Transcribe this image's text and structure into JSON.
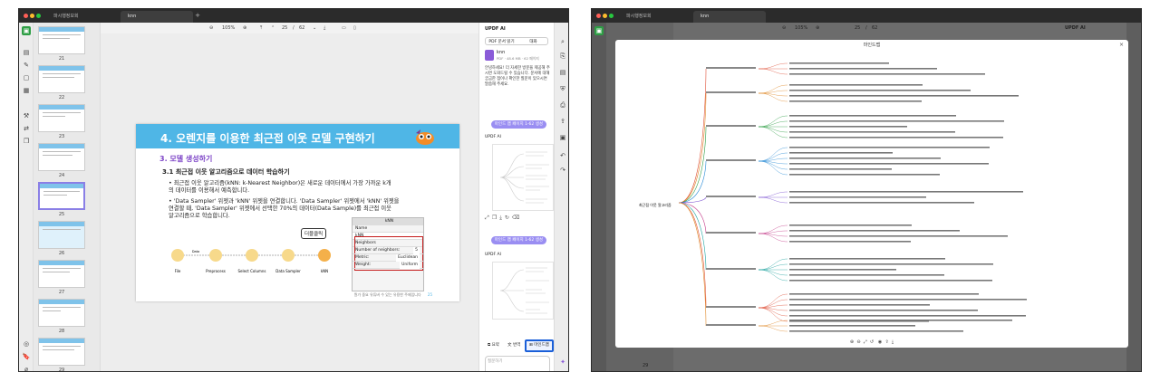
{
  "left_window": {
    "tabs": [
      "파시행정보회",
      "knn"
    ],
    "toolbar": {
      "zoom": "105%",
      "page_current": "25",
      "page_sep": "/",
      "page_total": "62"
    },
    "thumbnails": [
      "21",
      "22",
      "23",
      "24",
      "25",
      "26",
      "27",
      "28",
      "29"
    ],
    "slide": {
      "title": "4. 오렌지를 이용한 최근접 이웃 모델 구현하기",
      "subtitle": "3. 모델 생성하기",
      "section": "3.1 최근접 이웃 알고리즘으로 데이터 학습하기",
      "bullet1_l1": "• 최근접 이웃 알고리즘(kNN: k-Nearest Neighbor)은 새로운 데이터에서 가장 가까운 k개",
      "bullet1_l2": "  의 데이터를 이용해서 예측합니다.",
      "bullet2_l1": "• 'Data Sampler' 위젯과 'kNN' 위젯을 연결합니다. 'Data Sampler' 위젯에서 'kNN' 위젯을",
      "bullet2_l2": "  연결할 때, 'Data Sampler' 위젯에서 선택한 70%의 데이터(Data Sample)를 최근접 이웃",
      "bullet2_l3": "  알고리즘으로 학습합니다.",
      "callout": "더블클릭",
      "flow_labels": [
        "File",
        "Data",
        "Preprocess",
        "Select Columns",
        "Data Sampler",
        "kNN"
      ],
      "dialog": {
        "title": "kNN",
        "name_label": "Name",
        "name_value": "kNN",
        "group": "Neighbors",
        "neighbors_label": "Number of neighbors:",
        "neighbors_value": "5",
        "metric_label": "Metric:",
        "metric_value": "Euclidean",
        "weight_label": "Weight:",
        "weight_value": "Uniform"
      },
      "footer": "뭔가 중요 유튜버 수 있는 유용한 주제입니다",
      "page_no": "25"
    },
    "ai": {
      "header": "UPDF AI",
      "tab_a": "PDF 문서 읽기",
      "tab_b": "대화",
      "doc_name": "knn",
      "doc_meta": "PDF · 48.6 MB · 62 페이지",
      "intro": "안녕하세요! 더 자세한 방문을 제공해 주시면 도와드릴 수 있습니다. 문서에 대해 궁금한 점이나 확인한 질문이 있으시면 말씀해 주세요.",
      "pill1": "마인드 맵 페이지 1-62 생성",
      "pill2": "마인드 맵 페이지 1-62 생성",
      "label_ai1": "UPDF AI",
      "label_ai2": "UPDF AI",
      "btn_summary": "요약",
      "btn_translate": "번역",
      "btn_mindmap": "마인드맵",
      "placeholder": "질문하기"
    }
  },
  "right_window": {
    "tabs": [
      "파시행정보회",
      "knn"
    ],
    "toolbar": {
      "zoom": "105%",
      "page_current": "25",
      "page_sep": "/",
      "page_total": "62"
    },
    "ai_header": "UPDF AI",
    "mindmap_title": "마인드맵",
    "root": "최근접 이웃 알고리즘",
    "page_label": "29"
  },
  "colors": {
    "accent": "#4fb6e6",
    "purple": "#9a8ef2",
    "red": "#c51c1c",
    "blue_select": "#1a5fd8"
  }
}
